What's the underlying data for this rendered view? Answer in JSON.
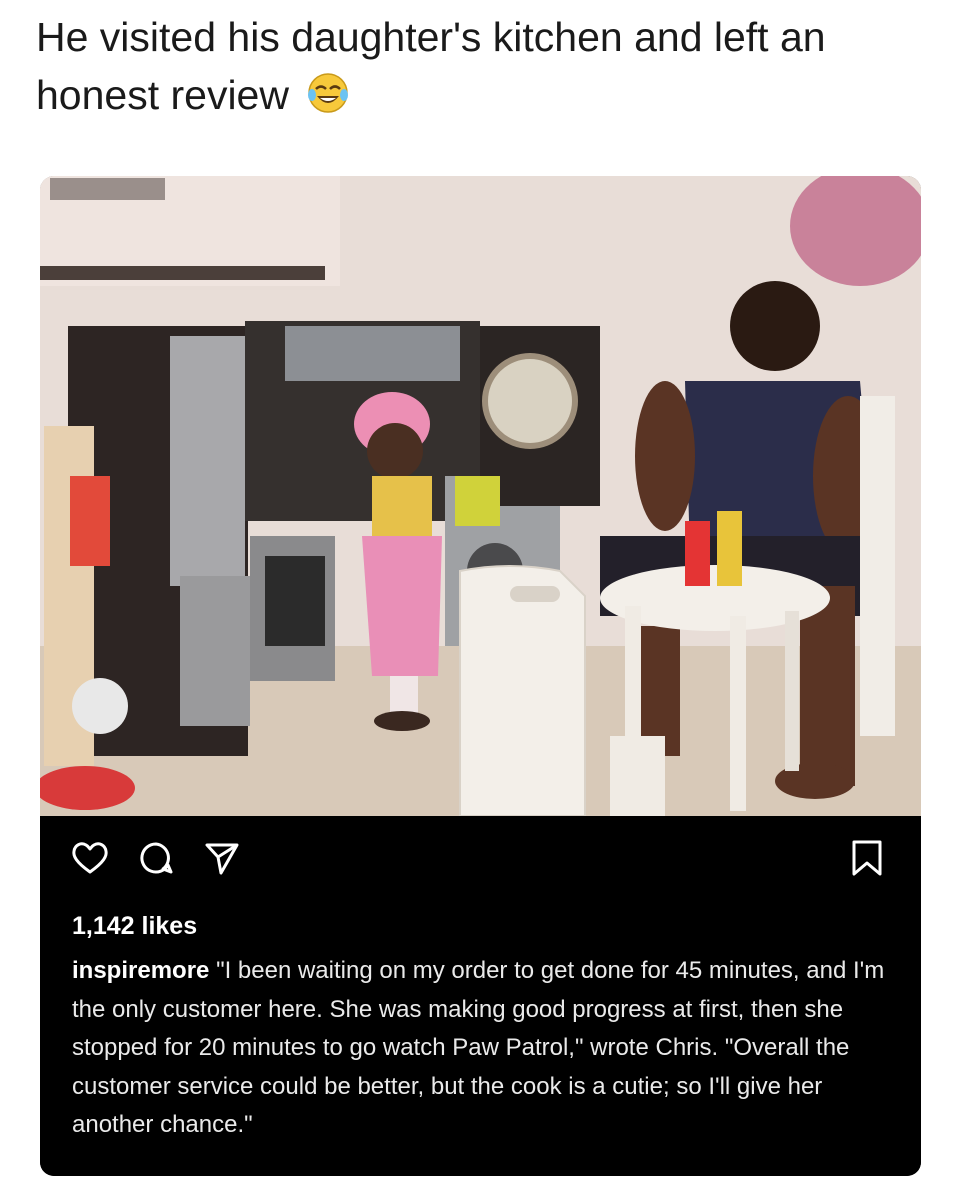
{
  "headline": {
    "text": "He visited his daughter's kitchen and left an honest review",
    "emoji": "tears-of-joy-emoji"
  },
  "post": {
    "photo_description_icon": "photo",
    "actions": {
      "like_icon": "heart-icon",
      "comment_icon": "comment-icon",
      "share_icon": "send-icon",
      "save_icon": "bookmark-icon"
    },
    "likes": "1,142 likes",
    "caption": {
      "username": "inspiremore",
      "text": "\"I been waiting on my order to get done for 45 minutes, and I'm the only customer here. She was making good progress at first, then she stopped for 20 minutes to go watch Paw Patrol,\" wrote Chris. \"Overall the customer service could be better, but the cook is a cutie; so I'll give her another chance.\""
    }
  },
  "colors": {
    "page_bg": "#ffffff",
    "post_bar_bg": "#000000",
    "text_light": "#eaeaea"
  }
}
